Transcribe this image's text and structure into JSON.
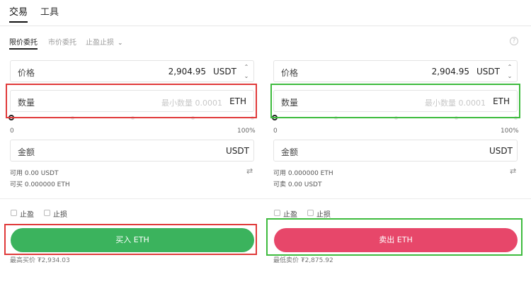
{
  "top_tabs": [
    "交易",
    "工具"
  ],
  "order_tabs": {
    "limit": "限价委托",
    "market": "市价委托",
    "tpsl": "止盈止损"
  },
  "help": "?",
  "buy": {
    "price_label": "价格",
    "price_value": "2,904.95",
    "price_unit": "USDT",
    "qty_label": "数量",
    "qty_placeholder": "最小数量 0.0001",
    "qty_unit": "ETH",
    "slider_min": "0",
    "slider_max": "100%",
    "slider_value": 0,
    "amount_label": "金额",
    "amount_unit": "USDT",
    "available": "可用 0.00 USDT",
    "can_trade": "可买 0.000000 ETH",
    "take_profit": "止盈",
    "stop_loss": "止损",
    "button": "买入 ETH",
    "best": "最高买价 ₮2,934.03"
  },
  "sell": {
    "price_label": "价格",
    "price_value": "2,904.95",
    "price_unit": "USDT",
    "qty_label": "数量",
    "qty_placeholder": "最小数量 0.0001",
    "qty_unit": "ETH",
    "slider_min": "0",
    "slider_max": "100%",
    "slider_value": 0,
    "amount_label": "金额",
    "amount_unit": "USDT",
    "available": "可用 0.000000 ETH",
    "can_trade": "可卖 0.00 USDT",
    "take_profit": "止盈",
    "stop_loss": "止损",
    "button": "卖出 ETH",
    "best": "最低卖价 ₮2,875.92"
  },
  "swap_icon": "⇄",
  "colors": {
    "buy": "#3bb35d",
    "sell": "#e7476a",
    "highlight_red": "#e03a3a",
    "highlight_green": "#3ebb3e"
  }
}
